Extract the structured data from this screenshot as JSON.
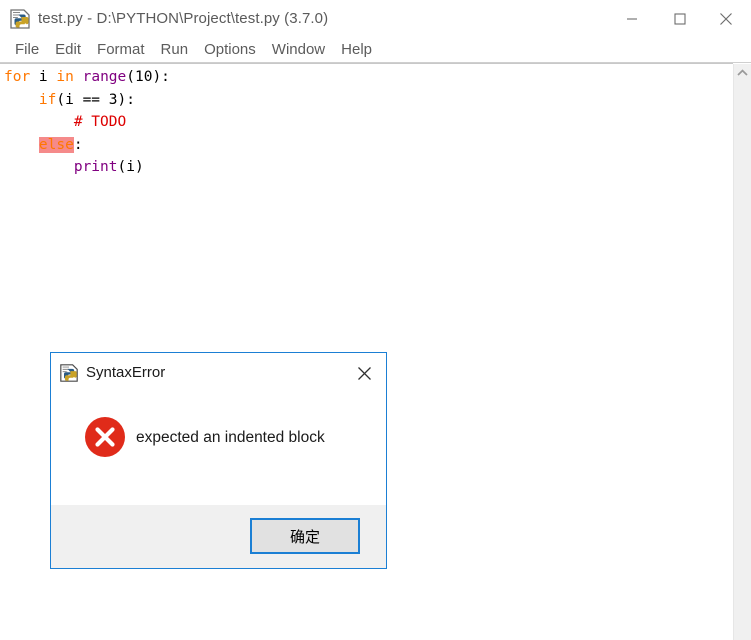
{
  "window": {
    "title": "test.py - D:\\PYTHON\\Project\\test.py (3.7.0)",
    "app_icon": "python-idle-icon",
    "controls": {
      "minimize": "minimize-icon",
      "maximize": "maximize-icon",
      "close": "close-icon"
    }
  },
  "menubar": {
    "items": [
      {
        "label": "File"
      },
      {
        "label": "Edit"
      },
      {
        "label": "Format"
      },
      {
        "label": "Run"
      },
      {
        "label": "Options"
      },
      {
        "label": "Window"
      },
      {
        "label": "Help"
      }
    ]
  },
  "editor": {
    "lines": [
      {
        "text": "for i in range(10):"
      },
      {
        "text": "    if(i == 3):"
      },
      {
        "text": "        # TODO"
      },
      {
        "text": "    else:"
      },
      {
        "text": "        print(i)"
      }
    ],
    "error_highlight_token": "else",
    "colors": {
      "keyword": "#ff7700",
      "builtin": "#800080",
      "comment": "#dd0000",
      "error_bg": "#f58a8a",
      "text": "#000000",
      "background": "#ffffff"
    }
  },
  "scrollbar": {
    "up_arrow_icon": "chevron-up-icon",
    "track_color": "#f0f0f0"
  },
  "dialog": {
    "icon": "python-idle-icon",
    "title": "SyntaxError",
    "close_icon": "close-icon",
    "error_icon": "error-circle-x-icon",
    "message": "expected an indented block",
    "ok_button": "确定",
    "accent_color": "#1b7fd4",
    "error_color": "#e02b1a"
  }
}
